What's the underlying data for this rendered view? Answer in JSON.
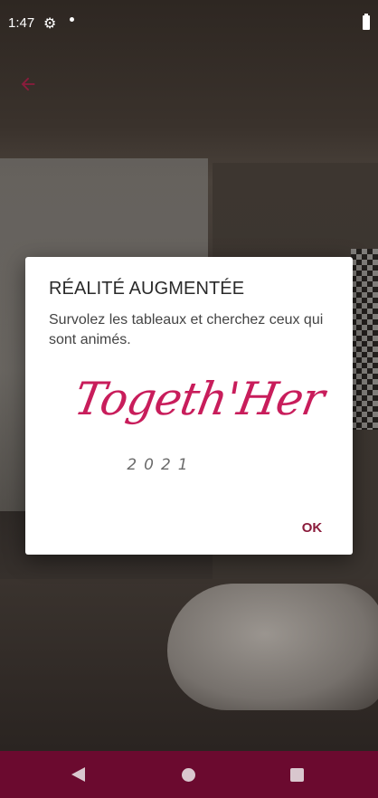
{
  "status_bar": {
    "time": "1:47",
    "icons": [
      "gear-icon",
      "notification-dot-icon",
      "battery-icon"
    ]
  },
  "header": {
    "back_icon": "back-arrow-icon",
    "accent_color": "#8b1c3c"
  },
  "dialog": {
    "title": "RÉALITÉ AUGMENTÉE",
    "message": "Survolez les tableaux et cherchez ceux qui sont animés.",
    "logo": {
      "script_text": "Togeth'Her",
      "year": "2021",
      "color": "#c81d5b"
    },
    "ok_label": "OK"
  },
  "nav_bar": {
    "color": "#6b0a2f",
    "buttons": [
      "back-triangle-icon",
      "home-circle-icon",
      "recents-square-icon"
    ]
  }
}
